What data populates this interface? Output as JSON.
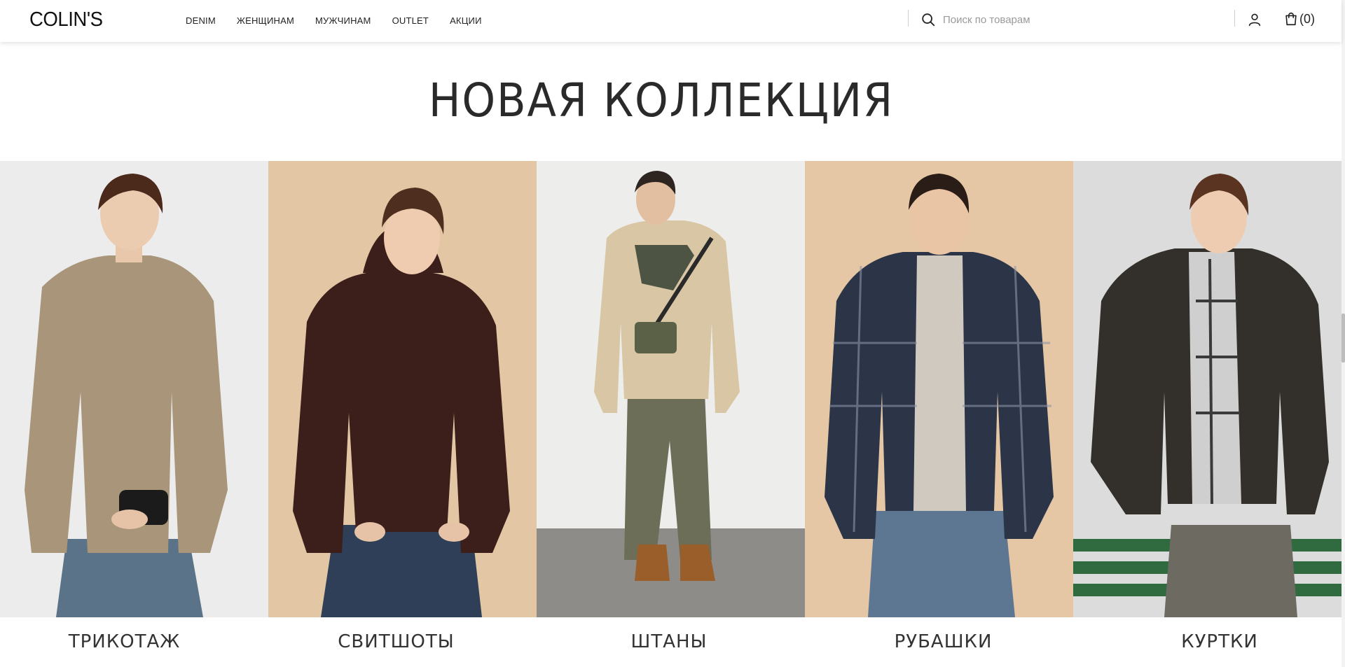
{
  "brand": {
    "logo_text": "COLIN'S"
  },
  "nav": {
    "items": [
      "DENIM",
      "ЖЕНЩИНАМ",
      "МУЖЧИНАМ",
      "OUTLET",
      "АКЦИИ"
    ]
  },
  "search": {
    "placeholder": "Поиск по товарам",
    "icon": "search-icon"
  },
  "header_actions": {
    "account_icon": "user-icon",
    "cart_icon": "shopping-bag-icon",
    "cart_count": "(0)"
  },
  "section": {
    "title": "НОВАЯ КОЛЛЕКЦИЯ"
  },
  "categories": [
    {
      "label": "ТРИКОТАЖ",
      "background": "#ececec",
      "garment": "#a99579"
    },
    {
      "label": "СВИТШОТЫ",
      "background": "#e3c7a4",
      "garment": "#3c1e1b"
    },
    {
      "label": "ШТАНЫ",
      "background": "#ededeb",
      "garment": "#d8c6a4"
    },
    {
      "label": "РУБАШКИ",
      "background": "#e5c7a5",
      "garment": "#2b3547"
    },
    {
      "label": "КУРТКИ",
      "background": "#dcdcdc",
      "garment": "#33302b"
    }
  ]
}
